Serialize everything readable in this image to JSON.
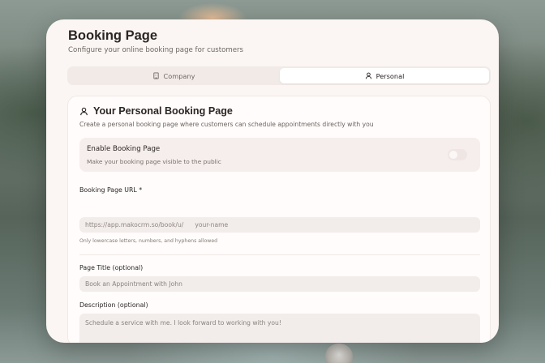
{
  "header": {
    "title": "Booking Page",
    "subtitle": "Configure your online booking page for customers"
  },
  "tabs": [
    {
      "label": "Company",
      "icon": "building-icon",
      "active": false
    },
    {
      "label": "Personal",
      "icon": "user-icon",
      "active": true
    }
  ],
  "panel": {
    "title": "Your Personal Booking Page",
    "description": "Create a personal booking page where customers can schedule appointments directly with you",
    "enable": {
      "title": "Enable Booking Page",
      "subtitle": "Make your booking page visible to the public",
      "enabled": false
    },
    "url_field": {
      "label": "Booking Page URL *",
      "prefix": "https://app.makocrm.so/book/u/",
      "placeholder": "your-name",
      "hint": "Only lowercase letters, numbers, and hyphens allowed"
    },
    "title_field": {
      "label": "Page Title (optional)",
      "placeholder": "Book an Appointment with John"
    },
    "description_field": {
      "label": "Description (optional)",
      "placeholder": "Schedule a service with me. I look forward to working with you!"
    }
  },
  "colors": {
    "card_bg": "#fbf6f4",
    "text_primary": "#2a2624",
    "text_muted": "#6e6762",
    "input_bg": "#f2eceb"
  }
}
